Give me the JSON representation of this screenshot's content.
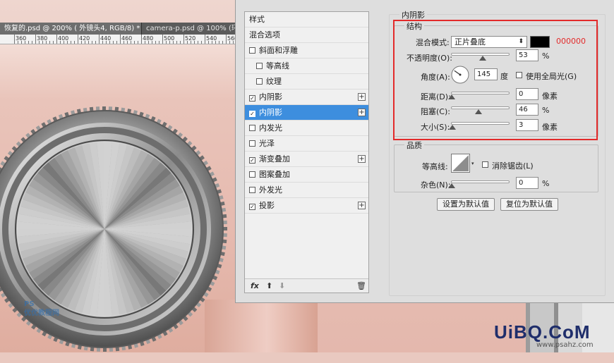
{
  "document_tabs": [
    {
      "label": "恢复的.psd @ 200% ( 外镜头4, RGB/8) *",
      "close": "×"
    },
    {
      "label": "camera-p.psd @ 100% (环2",
      "close": ""
    }
  ],
  "ruler": [
    "360",
    "380",
    "400",
    "420",
    "440",
    "460",
    "480",
    "500",
    "520",
    "540",
    "560"
  ],
  "styles_panel": {
    "items": [
      {
        "label": "样式",
        "checkbox": false,
        "checked": false,
        "plus": false,
        "indent": false
      },
      {
        "label": "混合选项",
        "checkbox": false,
        "checked": false,
        "plus": false,
        "indent": false
      },
      {
        "label": "斜面和浮雕",
        "checkbox": true,
        "checked": false,
        "plus": false,
        "indent": false
      },
      {
        "label": "等高线",
        "checkbox": true,
        "checked": false,
        "plus": false,
        "indent": true
      },
      {
        "label": "纹理",
        "checkbox": true,
        "checked": false,
        "plus": false,
        "indent": true
      },
      {
        "label": "内阴影",
        "checkbox": true,
        "checked": true,
        "plus": true,
        "indent": false
      },
      {
        "label": "内阴影",
        "checkbox": true,
        "checked": true,
        "plus": true,
        "indent": false,
        "selected": true
      },
      {
        "label": "内发光",
        "checkbox": true,
        "checked": false,
        "plus": false,
        "indent": false
      },
      {
        "label": "光泽",
        "checkbox": true,
        "checked": false,
        "plus": false,
        "indent": false
      },
      {
        "label": "渐变叠加",
        "checkbox": true,
        "checked": true,
        "plus": true,
        "indent": false
      },
      {
        "label": "图案叠加",
        "checkbox": true,
        "checked": false,
        "plus": false,
        "indent": false
      },
      {
        "label": "外发光",
        "checkbox": true,
        "checked": false,
        "plus": false,
        "indent": false
      },
      {
        "label": "投影",
        "checkbox": true,
        "checked": true,
        "plus": true,
        "indent": false
      }
    ],
    "footer": {
      "fx": "fx",
      "up": "⬆",
      "down": "⬇",
      "trash": "🗑"
    }
  },
  "inner_shadow": {
    "title": "内阴影",
    "structure": {
      "title": "结构",
      "blend_mode_label": "混合模式:",
      "blend_mode_value": "正片叠底",
      "color_hex": "000000",
      "color": "#000000",
      "opacity_label": "不透明度(O):",
      "opacity_value": "53",
      "opacity_unit": "%",
      "angle_label": "角度(A):",
      "angle_value": "145",
      "angle_unit": "度",
      "global_light_label": "使用全局光(G)",
      "distance_label": "距离(D):",
      "distance_value": "0",
      "distance_unit": "像素",
      "choke_label": "阻塞(C):",
      "choke_value": "46",
      "choke_unit": "%",
      "size_label": "大小(S):",
      "size_value": "3",
      "size_unit": "像素"
    },
    "quality": {
      "title": "品质",
      "contour_label": "等高线:",
      "anti_alias_label": "消除锯齿(L)",
      "noise_label": "杂色(N):",
      "noise_value": "0",
      "noise_unit": "%"
    },
    "buttons": {
      "set_default": "设置为默认值",
      "reset_default": "复位为默认值"
    }
  },
  "watermarks": {
    "left_top": "PS",
    "left_bottom": "优优教程网",
    "uibq": "UiBQ.CoM",
    "url": "www.psahz.com"
  },
  "colors": {
    "highlight": "#e32a2a",
    "selection": "#3d8ede"
  }
}
